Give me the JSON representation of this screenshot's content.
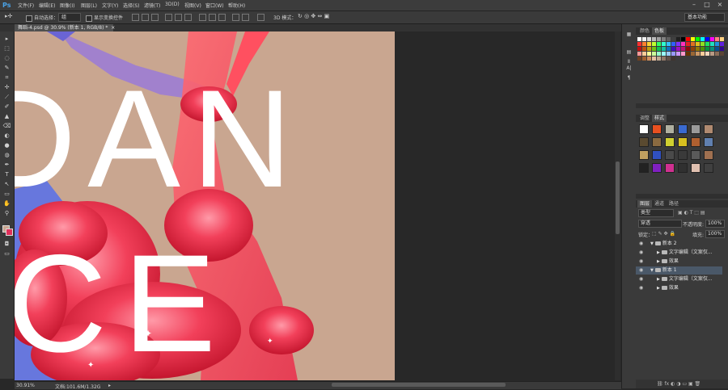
{
  "app": {
    "logo": "Ps"
  },
  "menu": [
    "文件(F)",
    "编辑(E)",
    "图像(I)",
    "图层(L)",
    "文字(Y)",
    "选择(S)",
    "滤镜(T)",
    "3D(D)",
    "视图(V)",
    "窗口(W)",
    "帮助(H)"
  ],
  "window_controls": [
    "–",
    "□",
    "×"
  ],
  "options_bar": {
    "auto_select_label": "自动选择：",
    "auto_select_value": "组",
    "show_transform_label": "显示变换控件",
    "mode_3d_label": "3D 模式：",
    "workspace_value": "基本功能"
  },
  "document": {
    "tab_title": "舞蹈-4.psd @ 30.9% (新本 1, RGB/8) *",
    "tab_close": "×",
    "canvas_text_top": "DAN",
    "canvas_text_bottom": "CE"
  },
  "status": {
    "zoom": "30.91%",
    "doc_info": "文档:101.6M/1.32G",
    "arrow": "▸"
  },
  "tools": [
    "▸",
    "⬚",
    "◌",
    "✎",
    "⌗",
    "✢",
    "⟋",
    "✐",
    "▲",
    "⌫",
    "◐",
    "●",
    "◍",
    "✒",
    "T",
    "↖",
    "▭",
    "✋",
    "⚲"
  ],
  "mini_panel_icons": [
    "▦",
    "▤",
    "Ⅱ",
    "A|",
    "¶"
  ],
  "panels": {
    "color_tabs": [
      "颜色",
      "色板"
    ],
    "style_tabs": [
      "调整",
      "样式"
    ],
    "layers_tabs": [
      "图层",
      "通道",
      "路径"
    ],
    "filter_kind": "类型",
    "blend_mode": "穿透",
    "opacity_label": "不透明度:",
    "opacity_value": "100%",
    "lock_label": "锁定：",
    "fill_label": "填充:",
    "fill_value": "100%"
  },
  "layers": [
    {
      "name": "新本 2",
      "indent": 0,
      "expanded": true,
      "selected": false
    },
    {
      "name": "文字编辑（文案仅...",
      "indent": 1,
      "expanded": false,
      "selected": false
    },
    {
      "name": "效果",
      "indent": 1,
      "expanded": false,
      "selected": false
    },
    {
      "name": "新本 1",
      "indent": 0,
      "expanded": true,
      "selected": true
    },
    {
      "name": "文字编辑（文案仅...",
      "indent": 1,
      "expanded": false,
      "selected": false
    },
    {
      "name": "效果",
      "indent": 1,
      "expanded": false,
      "selected": false
    }
  ],
  "colors": {
    "foreground": "#c9a690",
    "background": "#e0305a",
    "accent": "#4aa3e8",
    "selected_layer": "#4a5868"
  }
}
